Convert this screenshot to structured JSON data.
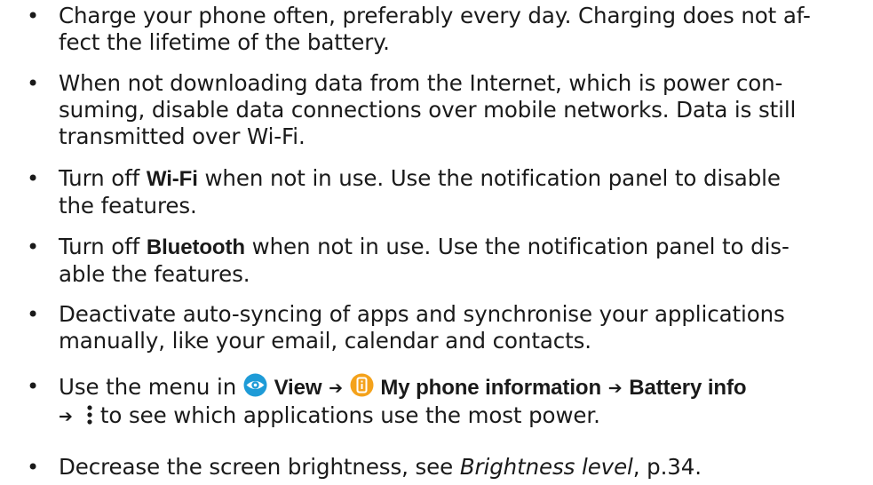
{
  "tips": [
    {
      "lines": [
        "Charge your phone often, preferably every day. Charging does not af-",
        "fect the lifetime of the battery."
      ]
    },
    {
      "lines": [
        "When not downloading data from the Internet, which is power con-",
        "suming, disable data connections over mobile networks. Data is still",
        "transmitted over Wi-Fi."
      ]
    },
    {
      "line1_prefix": "Turn off ",
      "line1_bold": "Wi-Fi",
      "line1_suffix": " when not in use. Use the notification panel to disable",
      "line2": "the features."
    },
    {
      "line1_prefix": "Turn off ",
      "line1_bold": "Bluetooth",
      "line1_suffix": " when not in use. Use the notification panel to dis-",
      "line2": "able the features."
    },
    {
      "lines": [
        "Deactivate auto-syncing of apps and synchronise your applications",
        "manually, like your email, calendar and contacts."
      ]
    },
    {
      "line1_prefix": "Use the menu in ",
      "view_label": "View",
      "arrow": "➔",
      "info_label": "My phone information",
      "battery_label": "Battery info",
      "line2_suffix": " to see which applications use the most power."
    },
    {
      "prefix": "Decrease the screen brightness, see ",
      "ref": "Brightness level",
      "suffix": ", p.34."
    }
  ],
  "bullet": "•",
  "icons": {
    "view": "eye-icon",
    "info": "phone-info-icon",
    "more": "more-vertical-icon"
  },
  "colors": {
    "view_icon": "#1E9BD7",
    "info_icon": "#F4A21B",
    "text": "#1a1a1a"
  }
}
